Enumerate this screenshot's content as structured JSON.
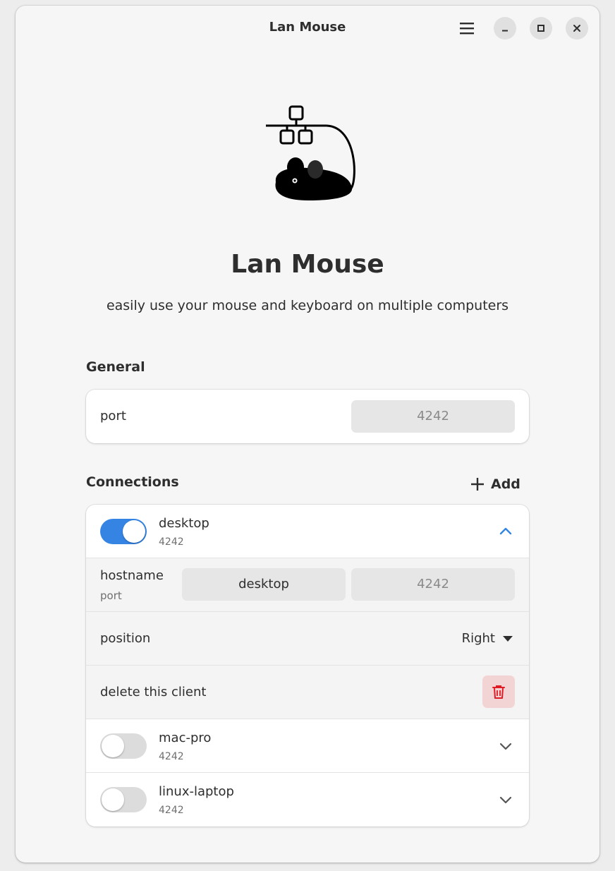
{
  "window": {
    "title": "Lan Mouse"
  },
  "header": {
    "title": "Lan Mouse",
    "subtitle": "easily use your mouse and keyboard on multiple computers"
  },
  "general": {
    "section_title": "General",
    "port_label": "port",
    "port_placeholder": "4242"
  },
  "connections": {
    "section_title": "Connections",
    "add_label": "Add",
    "clients": [
      {
        "name": "desktop",
        "port": "4242",
        "enabled": true,
        "expanded": true,
        "hostname_label": "hostname",
        "port_label": "port",
        "hostname_value": "desktop",
        "port_placeholder": "4242",
        "position_label": "position",
        "position_value": "Right",
        "delete_label": "delete this client"
      },
      {
        "name": "mac-pro",
        "port": "4242",
        "enabled": false,
        "expanded": false
      },
      {
        "name": "linux-laptop",
        "port": "4242",
        "enabled": false,
        "expanded": false
      }
    ]
  },
  "colors": {
    "accent": "#3584e4",
    "destructive": "#e01b24",
    "destructive_bg": "#f3d4d4"
  },
  "icons": [
    "open-menu-icon",
    "window-minimize-icon",
    "window-maximize-icon",
    "window-close-icon",
    "app-logo-icon",
    "add-icon",
    "chevron-up-icon",
    "chevron-down-icon",
    "dropdown-arrow-icon",
    "trash-icon"
  ]
}
